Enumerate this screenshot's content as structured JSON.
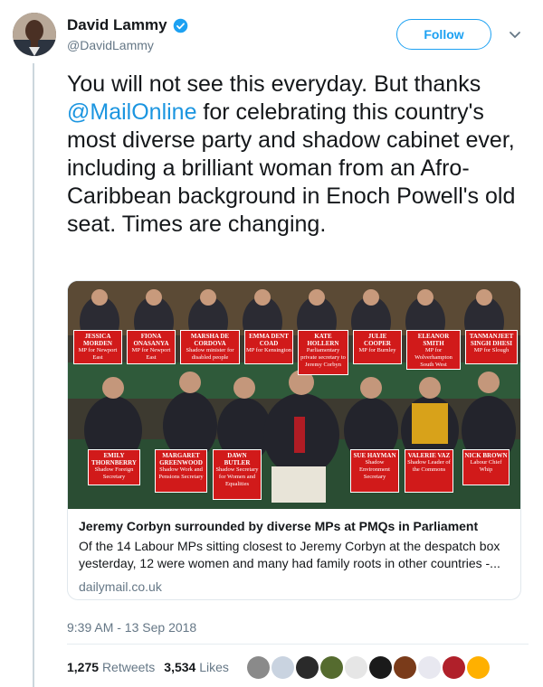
{
  "author": {
    "display_name": "David Lammy",
    "handle": "@DavidLammy",
    "verified": true,
    "avatar": "avatar-photo"
  },
  "actions": {
    "follow_label": "Follow",
    "menu_icon": "chevron-down-icon"
  },
  "tweet": {
    "text_before": "You will not see this everyday. But thanks ",
    "mention": "@MailOnline",
    "text_after": " for celebrating this country's most diverse party and shadow cabinet ever, including a brilliant woman from an Afro-Caribbean background in Enoch Powell's old seat. Times are changing."
  },
  "card": {
    "title": "Jeremy Corbyn surrounded by diverse MPs at PMQs in Parliament",
    "description": "Of the 14 Labour MPs sitting closest to Jeremy Corbyn at the despatch box yesterday, 12 were women and many had family roots in other countries -...",
    "domain": "dailymail.co.uk",
    "top_plaques": [
      {
        "name": "Jessica Morden",
        "role": "MP for Newport East"
      },
      {
        "name": "Fiona Onasanya",
        "role": "MP for Newport East"
      },
      {
        "name": "Marsha de Cordova",
        "role": "Shadow minister for disabled people"
      },
      {
        "name": "Emma Dent Coad",
        "role": "MP for Kensington"
      },
      {
        "name": "Kate Hollern",
        "role": "Parliamentary private secretary to Jeremy Corbyn"
      },
      {
        "name": "Julie Cooper",
        "role": "MP for Burnley"
      },
      {
        "name": "Eleanor Smith",
        "role": "MP for Wolverhampton South West"
      },
      {
        "name": "Tanmanjeet Singh Dhesi",
        "role": "MP for Slough"
      }
    ],
    "bottom_plaques": [
      {
        "name": "Emily Thornberry",
        "role": "Shadow Foreign Secretary"
      },
      {
        "name": "Margaret Greenwood",
        "role": "Shadow Work and Pensions Secretary"
      },
      {
        "name": "Dawn Butler",
        "role": "Shadow Secretary for Women and Equalities"
      },
      {
        "name": "Sue Hayman",
        "role": "Shadow Environment Secretary"
      },
      {
        "name": "Valerie Vaz",
        "role": "Shadow Leader of the Commons"
      },
      {
        "name": "Nick Brown",
        "role": "Labour Chief Whip"
      }
    ]
  },
  "timestamp": "9:39 AM - 13 Sep 2018",
  "stats": {
    "retweets_count": "1,275",
    "retweets_label": "Retweets",
    "likes_count": "3,534",
    "likes_label": "Likes"
  },
  "likers": [
    "#8a8a8a",
    "#c9d3e0",
    "#2a2a2a",
    "#556b2f",
    "#e6e6e6",
    "#1a1a1a",
    "#7a3b1a",
    "#e8e8f0",
    "#b0202a",
    "#ffb000"
  ],
  "colors": {
    "accent": "#1da1f2",
    "mention": "#1b95e0",
    "secondary_text": "#657786",
    "plaque_red": "#d11a1a"
  }
}
